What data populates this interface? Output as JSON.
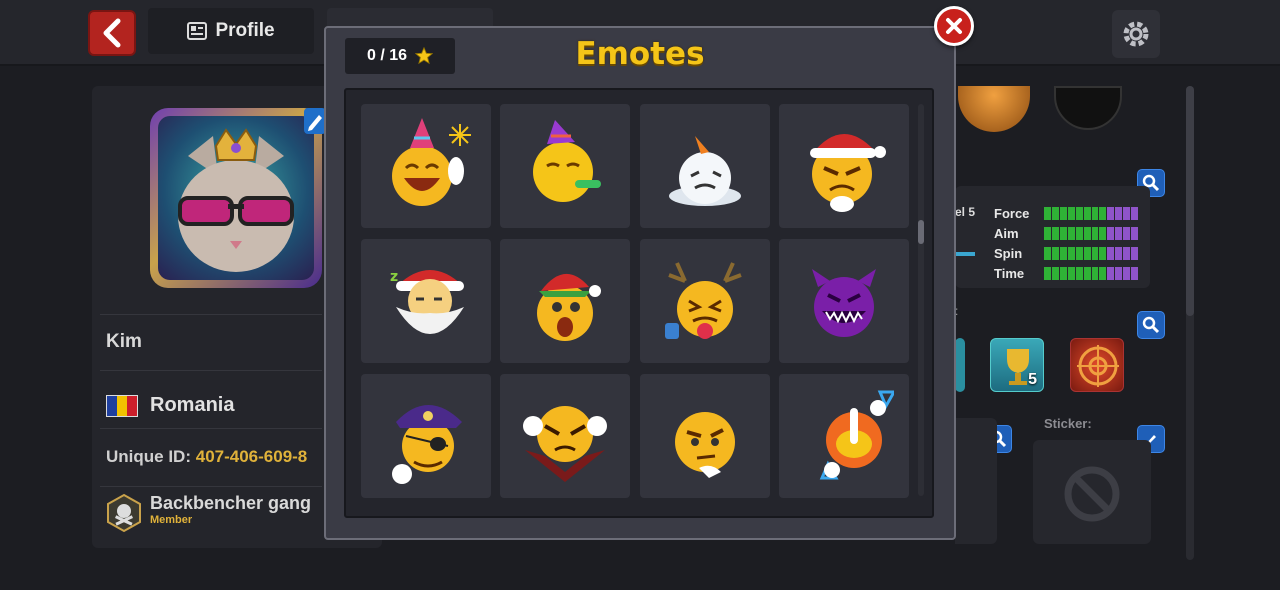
{
  "topbar": {
    "profile_tab_label": "Profile"
  },
  "profile": {
    "name": "Kim",
    "country": "Romania",
    "unique_id_label": "Unique ID:",
    "unique_id_value": "407-406-609-8",
    "club_name": "Backbencher gang",
    "club_role": "Member"
  },
  "stats": {
    "rows": [
      {
        "label": "Force",
        "filled": 0.7
      },
      {
        "label": "Aim",
        "filled": 0.7
      },
      {
        "label": "Spin",
        "filled": 0.7
      },
      {
        "label": "Time",
        "filled": 0.7
      }
    ],
    "level_text": "el 5"
  },
  "sticker": {
    "label": "Sticker:"
  },
  "trophy_count": "5",
  "modal": {
    "title": "Emotes",
    "star_counter": "0 / 16",
    "emotes": [
      {
        "name": "party-laugh-emote"
      },
      {
        "name": "party-blower-emote"
      },
      {
        "name": "snowman-emote"
      },
      {
        "name": "santa-angry-emote"
      },
      {
        "name": "santa-sleep-emote"
      },
      {
        "name": "elf-surprised-emote"
      },
      {
        "name": "reindeer-tongue-emote"
      },
      {
        "name": "purple-monster-emote"
      },
      {
        "name": "pirate-captain-emote"
      },
      {
        "name": "vampire-emote"
      },
      {
        "name": "thinking-angry-emote"
      },
      {
        "name": "robot-arrow-emote"
      }
    ]
  },
  "colors": {
    "title_yellow": "#f5c518",
    "accent_gold": "#e0b23a",
    "close_red": "#c8211c",
    "bar_green": "#2fb236",
    "bar_purple": "#8f54c9"
  }
}
